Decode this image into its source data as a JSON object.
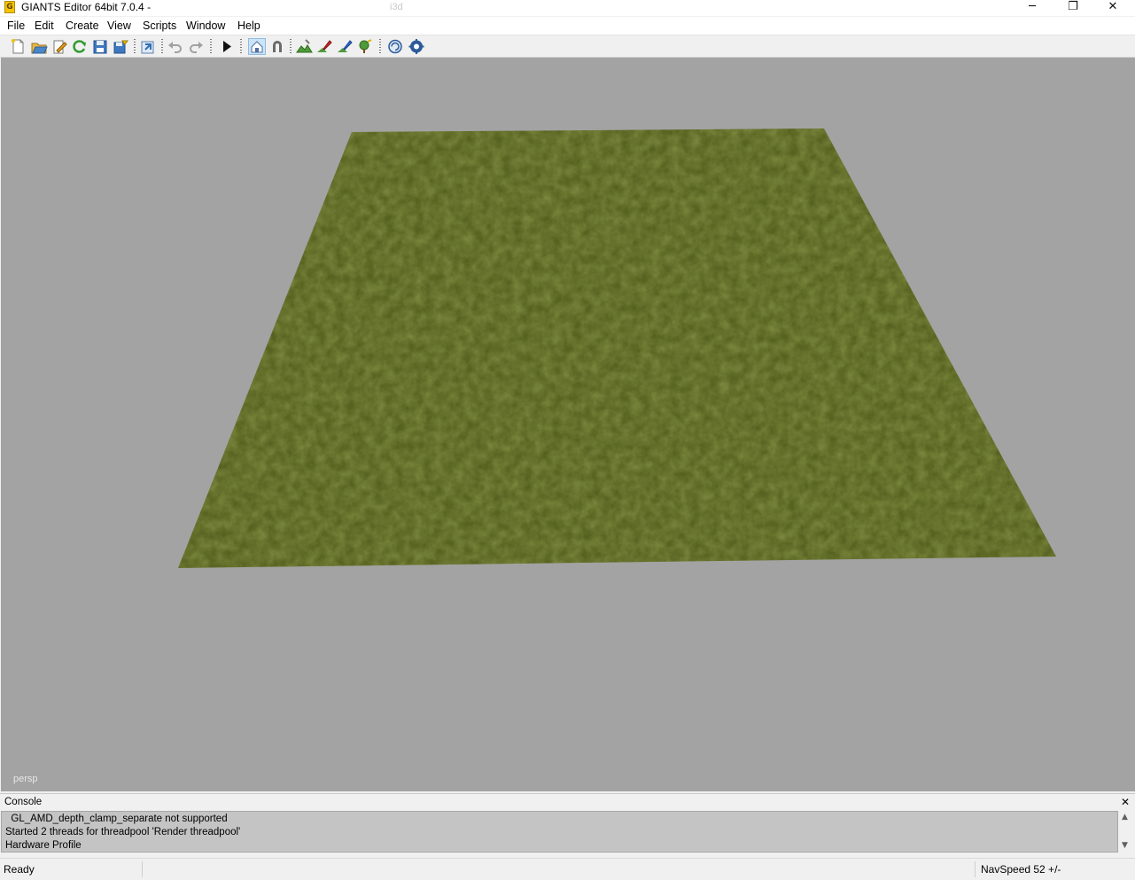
{
  "window": {
    "title": "GIANTS Editor 64bit 7.0.4 -",
    "faint_title": "i3d",
    "controls": {
      "minimize": "─",
      "maximize": "❐",
      "close": "✕"
    }
  },
  "menu": [
    "File",
    "Edit",
    "Create",
    "View",
    "Scripts",
    "Window",
    "Help"
  ],
  "toolbar": {
    "buttons": [
      "new-file-icon",
      "open-file-icon",
      "edit-script-icon",
      "reload-icon",
      "save-icon",
      "save-as-icon",
      "import-icon",
      "undo-icon",
      "redo-icon",
      "play-icon",
      "select-tool-icon",
      "magnet-icon",
      "terrain-sculpt-icon",
      "terrain-paint-icon",
      "foliage-paint-icon",
      "tree-paint-icon",
      "refresh-shaders-icon",
      "settings-icon"
    ],
    "active": "select-tool-icon"
  },
  "viewport": {
    "camera_label": "persp",
    "background_color": "#a3a3a3",
    "terrain_color": "#56621f"
  },
  "console": {
    "title": "Console",
    "close": "✕",
    "lines": [
      "  GL_AMD_depth_clamp_separate not supported",
      "Started 2 threads for threadpool 'Render threadpool'",
      "Hardware Profile"
    ]
  },
  "status": {
    "left": "Ready",
    "right": "NavSpeed 52 +/-"
  }
}
